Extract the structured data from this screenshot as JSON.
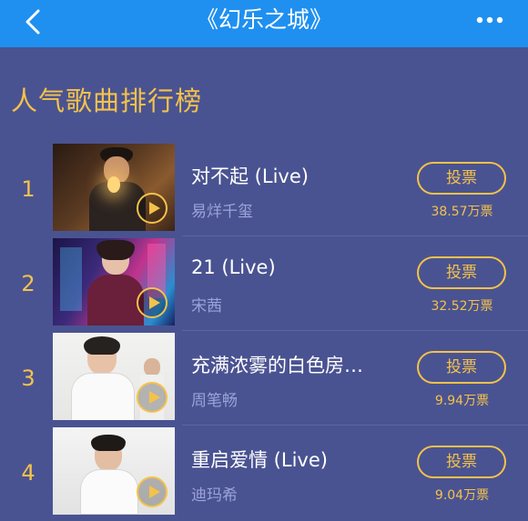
{
  "header": {
    "title": "《幻乐之城》",
    "back_icon": "chevron-left-icon",
    "more_icon": "more-dots-icon",
    "color": "#1f90f0"
  },
  "section": {
    "title": "人气歌曲排行榜"
  },
  "songs": [
    {
      "rank": "1",
      "title": "对不起 (Live)",
      "artist": "易烊千玺",
      "vote_label": "投票",
      "votes": "38.57万票"
    },
    {
      "rank": "2",
      "title": "21 (Live)",
      "artist": "宋茜",
      "vote_label": "投票",
      "votes": "32.52万票"
    },
    {
      "rank": "3",
      "title": "充满浓雾的白色房…",
      "artist": "周笔畅",
      "vote_label": "投票",
      "votes": "9.94万票"
    },
    {
      "rank": "4",
      "title": "重启爱情 (Live)",
      "artist": "迪玛希",
      "vote_label": "投票",
      "votes": "9.04万票"
    }
  ],
  "colors": {
    "background": "#4a5391",
    "accent": "#f4c24a",
    "secondary_text": "#9aa3d8"
  }
}
